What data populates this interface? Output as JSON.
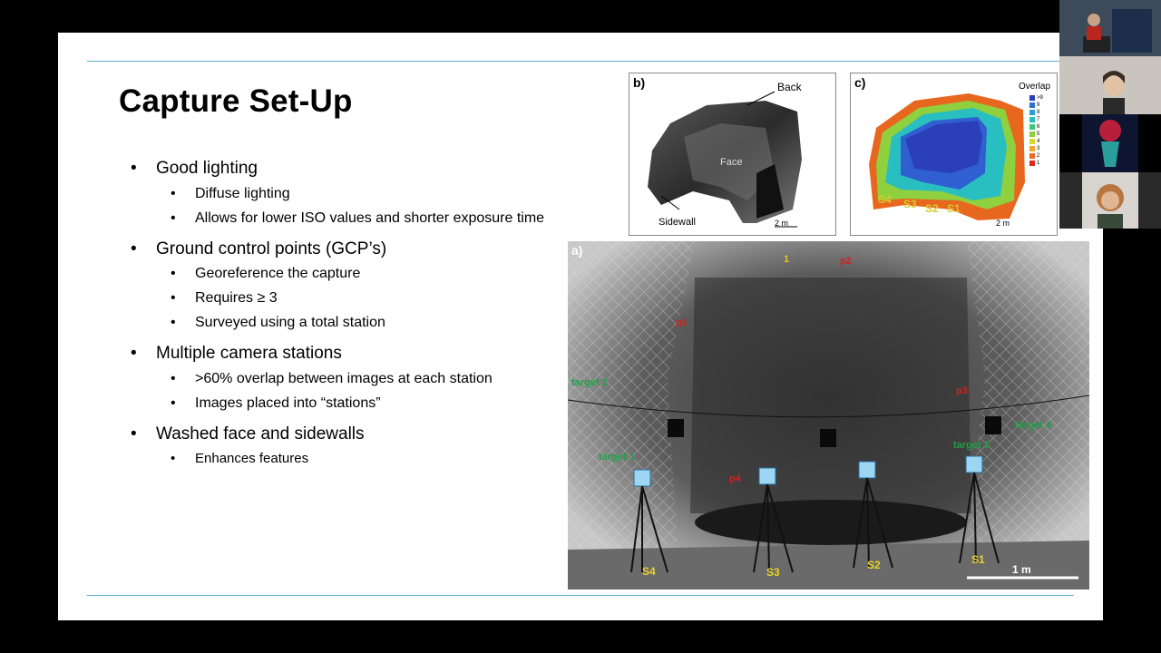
{
  "slide": {
    "title": "Capture Set-Up",
    "bullets": [
      {
        "text": "Good lighting",
        "subs": [
          "Diffuse lighting",
          "Allows for lower ISO values and shorter exposure time"
        ]
      },
      {
        "text": "Ground control points (GCP’s)",
        "subs": [
          "Georeference the capture",
          "Requires ≥ 3",
          "Surveyed using a total station"
        ]
      },
      {
        "text": "Multiple camera stations",
        "subs": [
          ">60% overlap between images at each station",
          "Images placed into “stations”"
        ]
      },
      {
        "text": "Washed face and sidewalls",
        "subs": [
          "Enhances features"
        ]
      }
    ],
    "bullet_symbol": "•"
  },
  "figure_b": {
    "label": "b)",
    "back": "Back",
    "face": "Face",
    "sidewall": "Sidewall",
    "scale": "2 m"
  },
  "figure_c": {
    "label": "c)",
    "legend_title": "Overlap",
    "legend": [
      ">9",
      "9",
      "8",
      "7",
      "6",
      "5",
      "4",
      "3",
      "2",
      "1"
    ],
    "legend_colors": [
      "#2b3fb8",
      "#2f6fd0",
      "#2a9fd6",
      "#29bfc0",
      "#3dc77a",
      "#8fd03e",
      "#d8d832",
      "#f0a92a",
      "#ee6b22",
      "#d62a1e"
    ],
    "stations": [
      "S4",
      "S3",
      "S2",
      "S1"
    ],
    "scale": "2 m"
  },
  "figure_a": {
    "label": "a)",
    "targets": [
      "target 1",
      "target 2",
      "target 3",
      "target 4"
    ],
    "points": [
      "p1",
      "p2",
      "p3",
      "p4",
      "1"
    ],
    "stations": [
      "S4",
      "S3",
      "S2",
      "S1"
    ],
    "scale": "1 m"
  },
  "participants": [
    {
      "name": "presenter-room-video",
      "icon": "person-icon"
    },
    {
      "name": "participant-video-2",
      "icon": "person-icon"
    },
    {
      "name": "participant-avatar-3",
      "icon": "avatar-icon"
    },
    {
      "name": "participant-video-4",
      "icon": "person-icon"
    }
  ]
}
